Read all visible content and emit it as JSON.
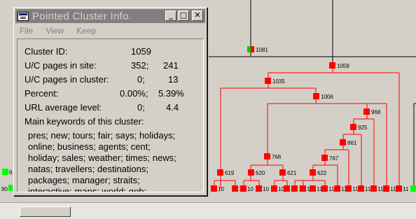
{
  "window": {
    "title": "Pointed Cluster Info.",
    "buttons": {
      "minimize": "_",
      "maximize": "□",
      "close": "✕"
    },
    "menu": [
      "File",
      "View",
      "Keep"
    ]
  },
  "info": {
    "cluster_id_label": "Cluster ID:",
    "cluster_id": "1059",
    "pages_site_label": "U/C pages in site:",
    "pages_site_u": "352;",
    "pages_site_c": "241",
    "pages_cluster_label": "U/C pages in cluster:",
    "pages_cluster_u": "0;",
    "pages_cluster_c": "13",
    "percent_label": "Percent:",
    "percent_u": "0.00%;",
    "percent_c": "5.39%",
    "url_level_label": "URL average level:",
    "url_level_u": "0;",
    "url_level_c": "4.4",
    "keywords_heading": "Main keywords of this cluster:",
    "keywords_lines": [
      "pres; new; tours; fair; says; holidays;",
      "online; business; agents; cent;",
      "holiday; sales; weather; times; news;",
      "natas; travellers; destinations;",
      "packages; manager; straits;",
      "interactive; maps; world; gob;"
    ]
  },
  "tree": {
    "colors": {
      "node": "#ff0000",
      "edge": "#ff0000",
      "black_edge": "#000000",
      "other_node": "#00ff00"
    },
    "nodes": {
      "n1081": "1081",
      "n1059": "1059",
      "n1035": "1035",
      "n1006": "1006",
      "n968": "968",
      "n925": "925",
      "n861": "861",
      "n767": "767",
      "n766": "766",
      "n619": "619",
      "n620": "620",
      "n621": "621",
      "n622": "622"
    },
    "left_edge_labels": {
      "a": "6",
      "b": "90"
    },
    "leaf_labels": [
      "10",
      "10",
      "10",
      "10",
      "10",
      "10",
      "11",
      "11",
      "11",
      "11",
      "11",
      "11",
      "11",
      "11",
      "11",
      "11"
    ]
  }
}
